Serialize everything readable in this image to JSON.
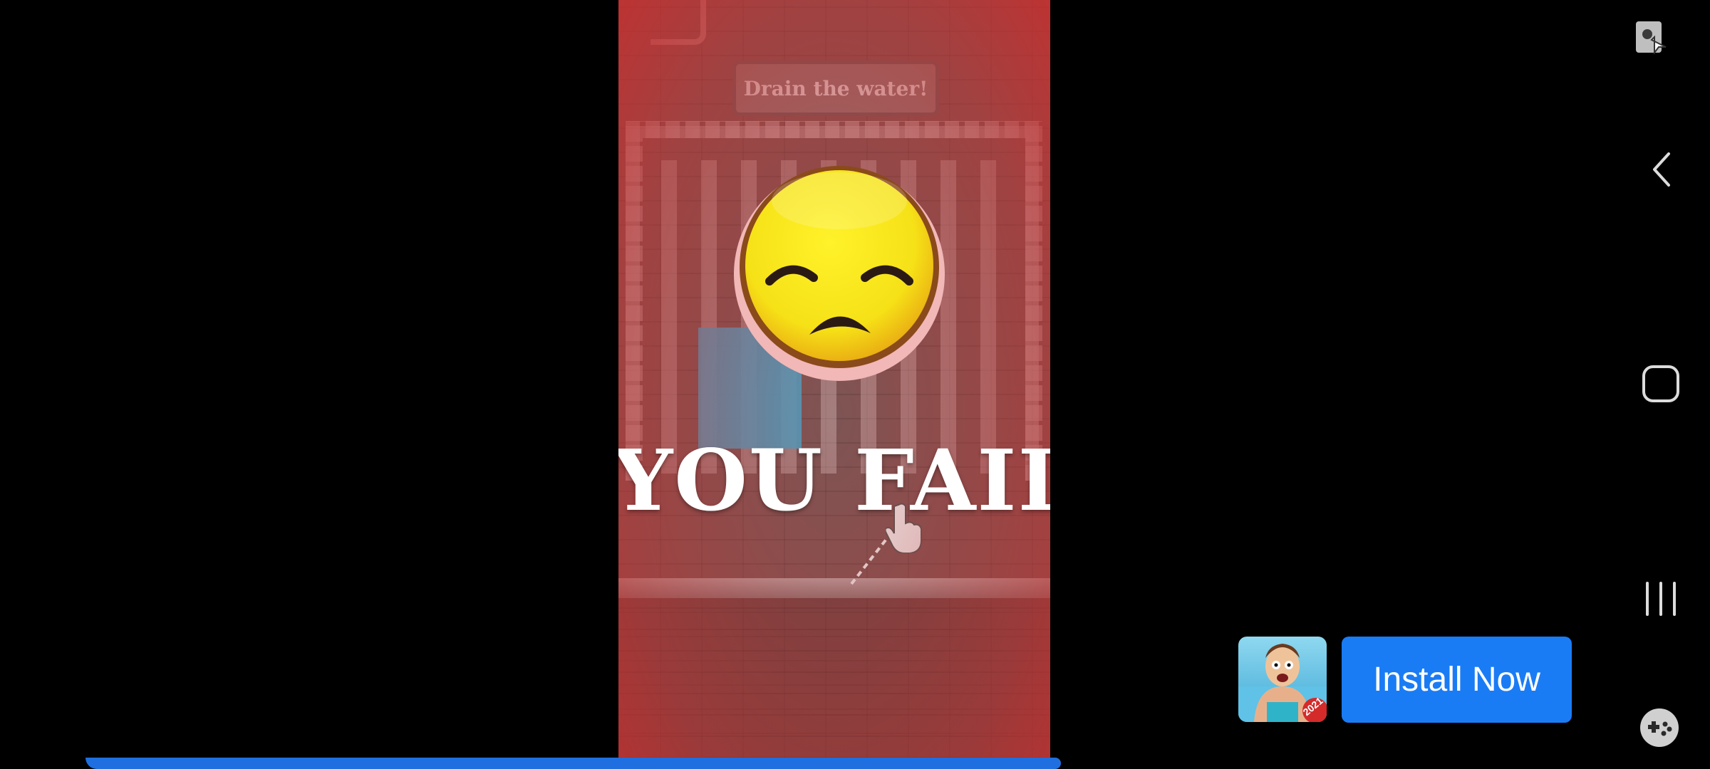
{
  "game": {
    "banner": "Drain the water!",
    "fail_message": "YOU FAIL!!"
  },
  "ad": {
    "install_label": "Install Now",
    "app_icon_badge": "2021",
    "accent_color": "#1a7cf5"
  },
  "video": {
    "progress": 0.78,
    "progress_color": "#1f6fe0"
  },
  "system_nav": {
    "icons": [
      "touch-lock-icon",
      "back-icon",
      "home-icon",
      "recents-icon",
      "game-tools-icon"
    ]
  }
}
